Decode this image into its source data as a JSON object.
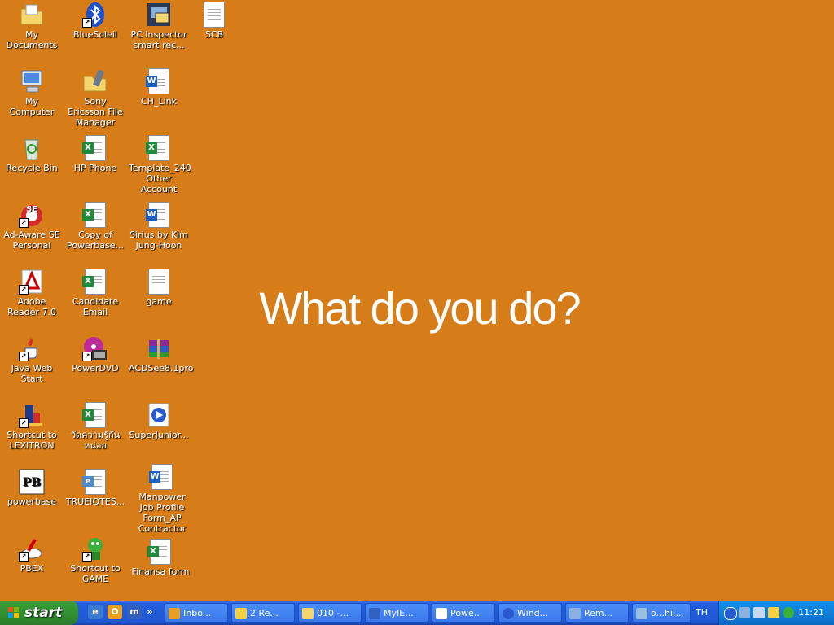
{
  "desktop": {
    "wallpaper_text": "What do you do?",
    "icons": [
      {
        "label": "My Documents"
      },
      {
        "label": "My Computer"
      },
      {
        "label": "Recycle Bin"
      },
      {
        "label": "Ad-Aware SE Personal"
      },
      {
        "label": "Adobe Reader 7.0"
      },
      {
        "label": "Java Web Start"
      },
      {
        "label": "Shortcut to LEXITRON"
      },
      {
        "label": "powerbase"
      },
      {
        "label": "PBEX"
      },
      {
        "label": "BlueSoleil"
      },
      {
        "label": "Sony Ericsson File Manager"
      },
      {
        "label": "HP Phone"
      },
      {
        "label": "Copy of Powerbase..."
      },
      {
        "label": "Candidate Email"
      },
      {
        "label": "PowerDVD"
      },
      {
        "label": "วัดความรู้กันหน่อย"
      },
      {
        "label": "TRUEIQTES..."
      },
      {
        "label": "Shortcut to GAME"
      },
      {
        "label": "PC Inspector smart rec..."
      },
      {
        "label": "CH_Link"
      },
      {
        "label": "Template_240 Other Account"
      },
      {
        "label": "Sirius by Kim Jung-Hoon"
      },
      {
        "label": "game"
      },
      {
        "label": "ACDSee8.1pro"
      },
      {
        "label": "SuperJunior..."
      },
      {
        "label": "Manpower Job Profile Form_AP Contractor"
      },
      {
        "label": "Finansa form"
      },
      {
        "label": "SCB"
      }
    ]
  },
  "taskbar": {
    "start_label": "start",
    "quicklaunch_overflow": "»",
    "tasks": [
      {
        "label": "Inbo..."
      },
      {
        "label": "2 Re..."
      },
      {
        "label": "010 -..."
      },
      {
        "label": "MyIE..."
      },
      {
        "label": "Powe..."
      },
      {
        "label": "Wind..."
      },
      {
        "label": "Rem..."
      },
      {
        "label": "o...hi...."
      }
    ],
    "language": "TH",
    "clock": "11:21"
  },
  "colors": {
    "wallpaper": "#d67c19",
    "taskbar": "#245edb",
    "start": "#2f8e2f",
    "tray": "#0f7cd8"
  }
}
